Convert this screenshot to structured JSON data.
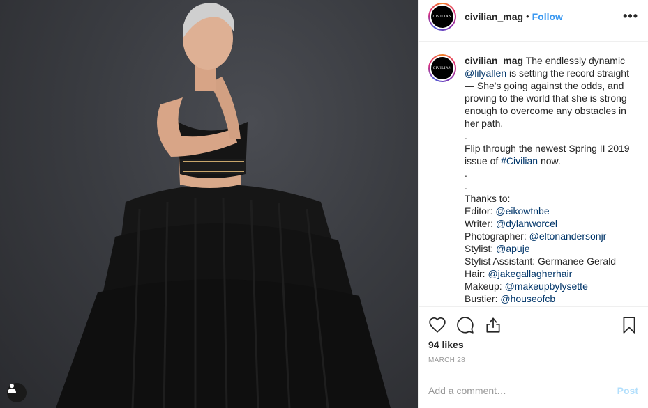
{
  "header": {
    "username": "civilian_mag",
    "separator": "•",
    "follow_label": "Follow",
    "more_label": "•••",
    "avatar_logo": "CIVILIAN"
  },
  "caption": {
    "username": "civilian_mag",
    "seg1": " The endlessly dynamic ",
    "mention_lilyallen": "@lilyallen",
    "seg2": " is setting the record straight — She's going against the odds, and proving to the world that she is strong enough to overcome any obstacles in her path.\n.\nFlip through the newest Spring II 2019 issue of ",
    "hashtag_civilian": "#Civilian",
    "seg3": " now.\n.\n.\nThanks to:\nEditor: ",
    "mention_editor": "@eikowtnbe",
    "seg4": "\nWriter: ",
    "mention_writer": "@dylanworcel",
    "seg5": "\nPhotographer: ",
    "mention_photographer": "@eltonandersonjr",
    "seg6": "\nStylist: ",
    "mention_stylist": "@apuje",
    "seg7": "\nStylist Assistant: Germanee Gerald\nHair: ",
    "mention_hair": "@jakegallagherhair",
    "seg8": "\nMakeup: ",
    "mention_makeup": "@makeupbylysette",
    "seg9": "\nBustier: ",
    "mention_bustier": "@houseofcb"
  },
  "actions": {
    "like_icon": "heart-icon",
    "comment_icon": "comment-icon",
    "share_icon": "share-icon",
    "save_icon": "bookmark-icon"
  },
  "likes": "94 likes",
  "date": "MARCH 28",
  "comment": {
    "placeholder": "Add a comment…",
    "post_label": "Post"
  },
  "colors": {
    "link_blue": "#3897f0",
    "mention_blue": "#003569",
    "post_disabled": "#b2dffc"
  }
}
